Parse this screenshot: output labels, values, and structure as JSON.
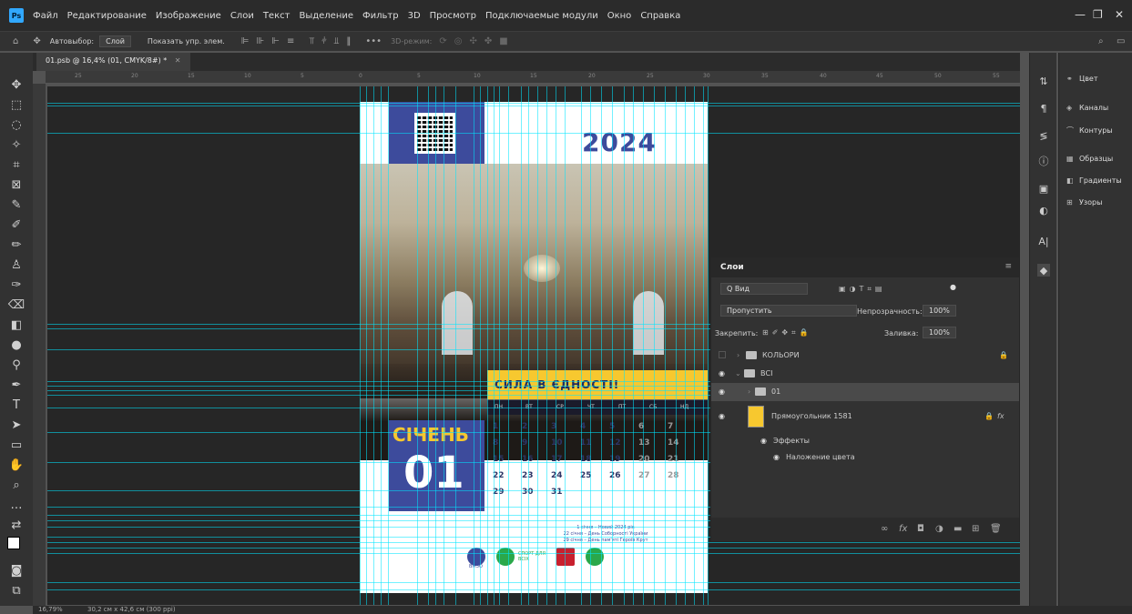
{
  "app": {
    "logo": "Ps",
    "menu": [
      "Файл",
      "Редактирование",
      "Изображение",
      "Слои",
      "Текст",
      "Выделение",
      "Фильтр",
      "3D",
      "Просмотр",
      "Подключаемые модули",
      "Окно",
      "Справка"
    ]
  },
  "options": {
    "autoselect_label": "Автовыбор:",
    "autoselect_value": "Слой",
    "show_controls": "Показать упр. элем.",
    "mode_3d": "3D-режим:"
  },
  "document": {
    "tab_title": "01.psb @ 16,4% (01, CMYK/8#) *",
    "ruler_ticks": [
      "25",
      "20",
      "15",
      "10",
      "5",
      "0",
      "5",
      "10",
      "15",
      "20",
      "25",
      "30",
      "35",
      "40",
      "45",
      "50",
      "55"
    ]
  },
  "calendar": {
    "year": "2024",
    "slogan": "СИЛА В ЄДНОСТІ!",
    "month": "СІЧЕНЬ",
    "month_number": "01",
    "weekdays": [
      "ПН",
      "ВТ",
      "СР",
      "ЧТ",
      "ПТ",
      "СБ",
      "НД"
    ],
    "weeks": [
      [
        "1",
        "2",
        "3",
        "4",
        "5",
        "6",
        "7"
      ],
      [
        "8",
        "9",
        "10",
        "11",
        "12",
        "13",
        "14"
      ],
      [
        "15",
        "16",
        "17",
        "18",
        "19",
        "20",
        "21"
      ],
      [
        "22",
        "23",
        "24",
        "25",
        "26",
        "27",
        "28"
      ],
      [
        "29",
        "30",
        "31",
        "",
        "",
        "",
        ""
      ]
    ],
    "holidays": [
      "1 січня – Новий 2024 рік",
      "22 січня – День Соборності України",
      "29 січня – День пам'яті Героїв Крут"
    ],
    "logo_text": "ВМЗО",
    "sport_logo": "СПОРТ ДЛЯ ВСІХ"
  },
  "layers_panel": {
    "tab": "Слои",
    "search_kind": "Q Вид",
    "blend_mode": "Пропустить",
    "opacity_label": "Непрозрачность:",
    "opacity_value": "100%",
    "lock_label": "Закрепить:",
    "fill_label": "Заливка:",
    "fill_value": "100%",
    "layers": [
      {
        "name": "КОЛЬОРИ"
      },
      {
        "name": "ВСІ"
      },
      {
        "name": "01"
      },
      {
        "name": "Прямоугольник 1581"
      },
      {
        "name": "Эффекты"
      },
      {
        "name": "Наложение цвета"
      }
    ]
  },
  "right_dock": {
    "items": [
      "Цвет",
      "Каналы",
      "Контуры",
      "Образцы",
      "Градиенты",
      "Узоры"
    ]
  },
  "status": {
    "zoom": "16,79%",
    "doc_size": "30,2 см x 42,6 см (300 ppi)"
  },
  "colors": {
    "brand_blue": "#3d4b9c",
    "brand_yellow": "#f7c82f",
    "guide_cyan": "#00e6ff"
  }
}
